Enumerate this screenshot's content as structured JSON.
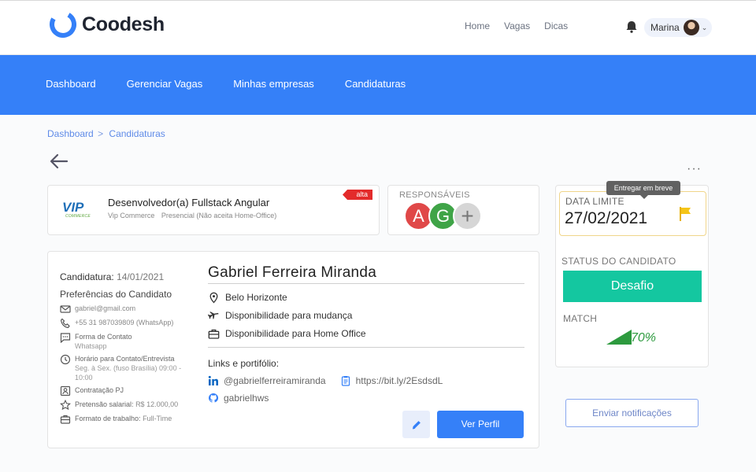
{
  "header": {
    "brand": "Coodesh",
    "nav": [
      "Home",
      "Vagas",
      "Dicas"
    ],
    "user_name": "Marina"
  },
  "main_nav": [
    "Dashboard",
    "Gerenciar Vagas",
    "Minhas empresas",
    "Candidaturas"
  ],
  "breadcrumb": {
    "root": "Dashboard",
    "separator": ">",
    "current": "Candidaturas"
  },
  "job": {
    "company_logo_text": "VIP",
    "company_logo_sub": "COMMERCE",
    "title": "Desenvolvedor(a) Fullstack Angular",
    "company": "Vip Commerce",
    "location": "Presencial (Não aceita Home-Office)",
    "priority": "alta"
  },
  "responsaveis": {
    "title": "RESPONSÁVEIS",
    "avatars": [
      "A",
      "G"
    ],
    "add_label": "+"
  },
  "status": {
    "tooltip": "Entregar em breve",
    "date_label": "DATA LIMITE",
    "date_value": "27/02/2021",
    "status_label": "STATUS DO CANDIDATO",
    "status_value": "Desafio",
    "match_label": "MATCH",
    "match_value": "70%",
    "notify_label": "Enviar notificações"
  },
  "candidate": {
    "applied_label": "Candidatura:",
    "applied_date": "14/01/2021",
    "prefs_title": "Preferências do Candidato",
    "email": "gabriel@gmail.com",
    "phone": "+55 31 987039809 (WhatsApp)",
    "contact_form_label": "Forma de Contato",
    "contact_form_value": "Whatsapp",
    "contact_hours_label": "Horário para Contato/Entrevista",
    "contact_hours_value": "Seg. à Sex. (fuso Brasília) 09:00 - 10:00",
    "hiring_label": "Contratação PJ",
    "salary_label": "Pretensão salarial:",
    "salary_value": "R$ 12.000,00",
    "work_format_label": "Formato de trabalho:",
    "work_format_value": "Full-Time",
    "name": "Gabriel Ferreira Miranda",
    "city": "Belo Horizonte",
    "relocation": "Disponibilidade para mudança",
    "home_office": "Disponibilidade para Home Office",
    "links_title": "Links e portifólio:",
    "linkedin": "@gabrielferreiramiranda",
    "portfolio": "https://bit.ly/2EsdsdL",
    "github": "gabrielhws",
    "profile_button": "Ver Perfil"
  },
  "colors": {
    "primary": "#3580f8",
    "status_green": "#14c7a0",
    "priority_red": "#e32b2b",
    "match_green": "#2d9a3e",
    "date_border": "#f0d58a",
    "flag": "#f5c518"
  },
  "icons": [
    "coodesh-logo-icon",
    "bell-icon",
    "back-arrow-icon",
    "more-dots-icon",
    "flag-icon",
    "email-icon",
    "phone-icon",
    "chat-icon",
    "clock-icon",
    "id-card-icon",
    "star-icon",
    "briefcase-icon",
    "location-pin-icon",
    "airplane-icon",
    "linkedin-icon",
    "clipboard-icon",
    "github-icon",
    "pencil-icon"
  ]
}
